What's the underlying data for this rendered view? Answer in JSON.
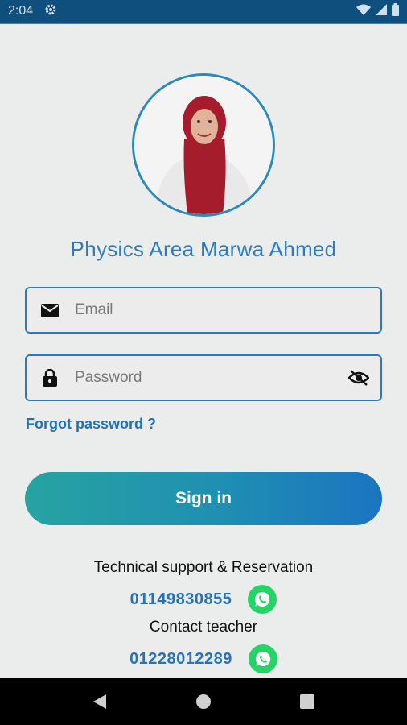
{
  "status_bar": {
    "time": "2:04",
    "icons": [
      "gear-icon",
      "wifi-icon",
      "signal-icon",
      "battery-icon"
    ]
  },
  "app": {
    "title": "Physics Area Marwa Ahmed"
  },
  "login": {
    "email_placeholder": "Email",
    "password_placeholder": "Password",
    "forgot_label": "Forgot password ?",
    "signin_label": "Sign in"
  },
  "contact": {
    "support_label": "Technical support & Reservation",
    "support_phone": "01149830855",
    "teacher_label": "Contact teacher",
    "teacher_phone": "01228012289"
  },
  "colors": {
    "accent": "#2e7cc0",
    "status_bar": "#0f4f7d",
    "whatsapp": "#25d366",
    "button_gradient_start": "#27a3a1",
    "button_gradient_end": "#1c74c1"
  },
  "nav": {
    "icons": [
      "back-icon",
      "home-icon",
      "recents-icon"
    ]
  }
}
